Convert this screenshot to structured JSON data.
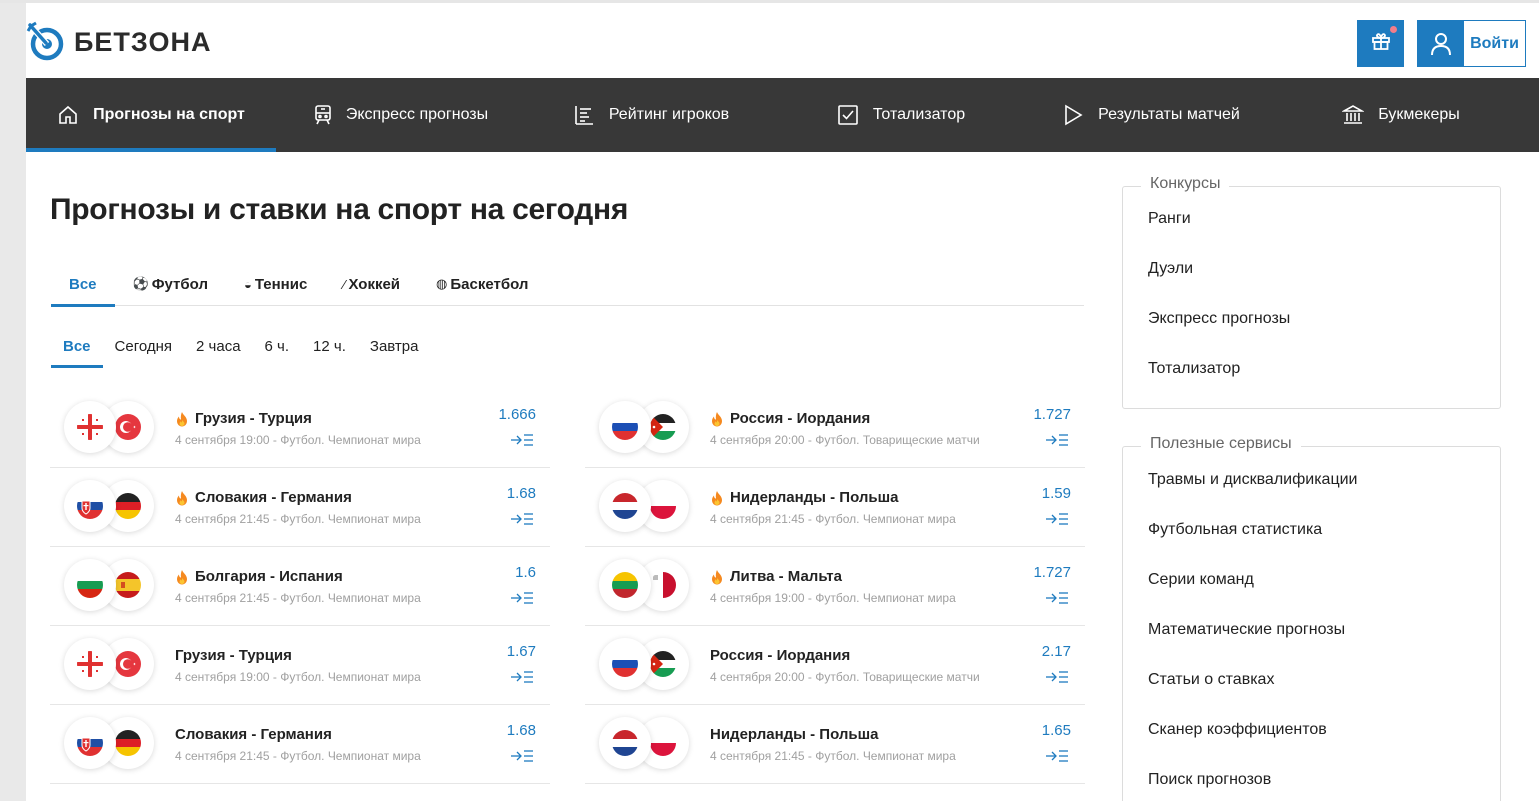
{
  "brand": {
    "name": "БЕТЗОНА",
    "accent": "#1e7bbf"
  },
  "header": {
    "gift_icon": "gift-icon",
    "login_icon": "user-icon",
    "login_label": "Войти"
  },
  "nav": {
    "items": [
      {
        "label": "Прогнозы на спорт",
        "icon": "home-icon",
        "active": true
      },
      {
        "label": "Экспресс прогнозы",
        "icon": "train-icon",
        "active": false
      },
      {
        "label": "Рейтинг игроков",
        "icon": "list-icon",
        "active": false
      },
      {
        "label": "Тотализатор",
        "icon": "checkbox-icon",
        "active": false
      },
      {
        "label": "Результаты матчей",
        "icon": "play-icon",
        "active": false
      },
      {
        "label": "Букмекеры",
        "icon": "bank-icon",
        "active": false
      }
    ]
  },
  "main": {
    "title": "Прогнозы и ставки на спорт на сегодня",
    "sport_tabs": [
      {
        "label": "Все",
        "icon": "",
        "active": true
      },
      {
        "label": "Футбол",
        "icon": "soccer-ball-icon",
        "active": false
      },
      {
        "label": "Теннис",
        "icon": "tennis-ball-icon",
        "active": false
      },
      {
        "label": "Хоккей",
        "icon": "hockey-stick-icon",
        "active": false
      },
      {
        "label": "Баскетбол",
        "icon": "basketball-icon",
        "active": false
      }
    ],
    "time_tabs": [
      {
        "label": "Все",
        "active": true
      },
      {
        "label": "Сегодня",
        "active": false
      },
      {
        "label": "2 часа",
        "active": false
      },
      {
        "label": "6 ч.",
        "active": false
      },
      {
        "label": "12 ч.",
        "active": false
      },
      {
        "label": "Завтра",
        "active": false
      }
    ],
    "left_matches": [
      {
        "teams": "Грузия - Турция",
        "meta": "4 сентября 19:00 - Футбол. Чемпионат мира",
        "odd": "1.666",
        "hot": true,
        "flags": [
          "georgia",
          "turkey"
        ]
      },
      {
        "teams": "Словакия - Германия",
        "meta": "4 сентября 21:45 - Футбол. Чемпионат мира",
        "odd": "1.68",
        "hot": true,
        "flags": [
          "slovakia",
          "germany"
        ]
      },
      {
        "teams": "Болгария - Испания",
        "meta": "4 сентября 21:45 - Футбол. Чемпионат мира",
        "odd": "1.6",
        "hot": true,
        "flags": [
          "bulgaria",
          "spain"
        ]
      },
      {
        "teams": "Грузия - Турция",
        "meta": "4 сентября 19:00 - Футбол. Чемпионат мира",
        "odd": "1.67",
        "hot": false,
        "flags": [
          "georgia",
          "turkey"
        ]
      },
      {
        "teams": "Словакия - Германия",
        "meta": "4 сентября 21:45 - Футбол. Чемпионат мира",
        "odd": "1.68",
        "hot": false,
        "flags": [
          "slovakia",
          "germany"
        ]
      }
    ],
    "right_matches": [
      {
        "teams": "Россия - Иордания",
        "meta": "4 сентября 20:00 - Футбол. Товарищеские матчи",
        "odd": "1.727",
        "hot": true,
        "flags": [
          "russia",
          "jordan"
        ]
      },
      {
        "teams": "Нидерланды - Польша",
        "meta": "4 сентября 21:45 - Футбол. Чемпионат мира",
        "odd": "1.59",
        "hot": true,
        "flags": [
          "netherlands",
          "poland"
        ]
      },
      {
        "teams": "Литва - Мальта",
        "meta": "4 сентября 19:00 - Футбол. Чемпионат мира",
        "odd": "1.727",
        "hot": true,
        "flags": [
          "lithuania",
          "malta"
        ]
      },
      {
        "teams": "Россия - Иордания",
        "meta": "4 сентября 20:00 - Футбол. Товарищеские матчи",
        "odd": "2.17",
        "hot": false,
        "flags": [
          "russia",
          "jordan"
        ]
      },
      {
        "teams": "Нидерланды - Польша",
        "meta": "4 сентября 21:45 - Футбол. Чемпионат мира",
        "odd": "1.65",
        "hot": false,
        "flags": [
          "netherlands",
          "poland"
        ]
      }
    ]
  },
  "sidebar": {
    "contests": {
      "title": "Конкурсы",
      "links": [
        "Ранги",
        "Дуэли",
        "Экспресс прогнозы",
        "Тотализатор"
      ]
    },
    "services": {
      "title": "Полезные сервисы",
      "links": [
        "Травмы и дисквалификации",
        "Футбольная статистика",
        "Серии команд",
        "Математические прогнозы",
        "Статьи о ставках",
        "Сканер коэффициентов",
        "Поиск прогнозов"
      ]
    }
  }
}
